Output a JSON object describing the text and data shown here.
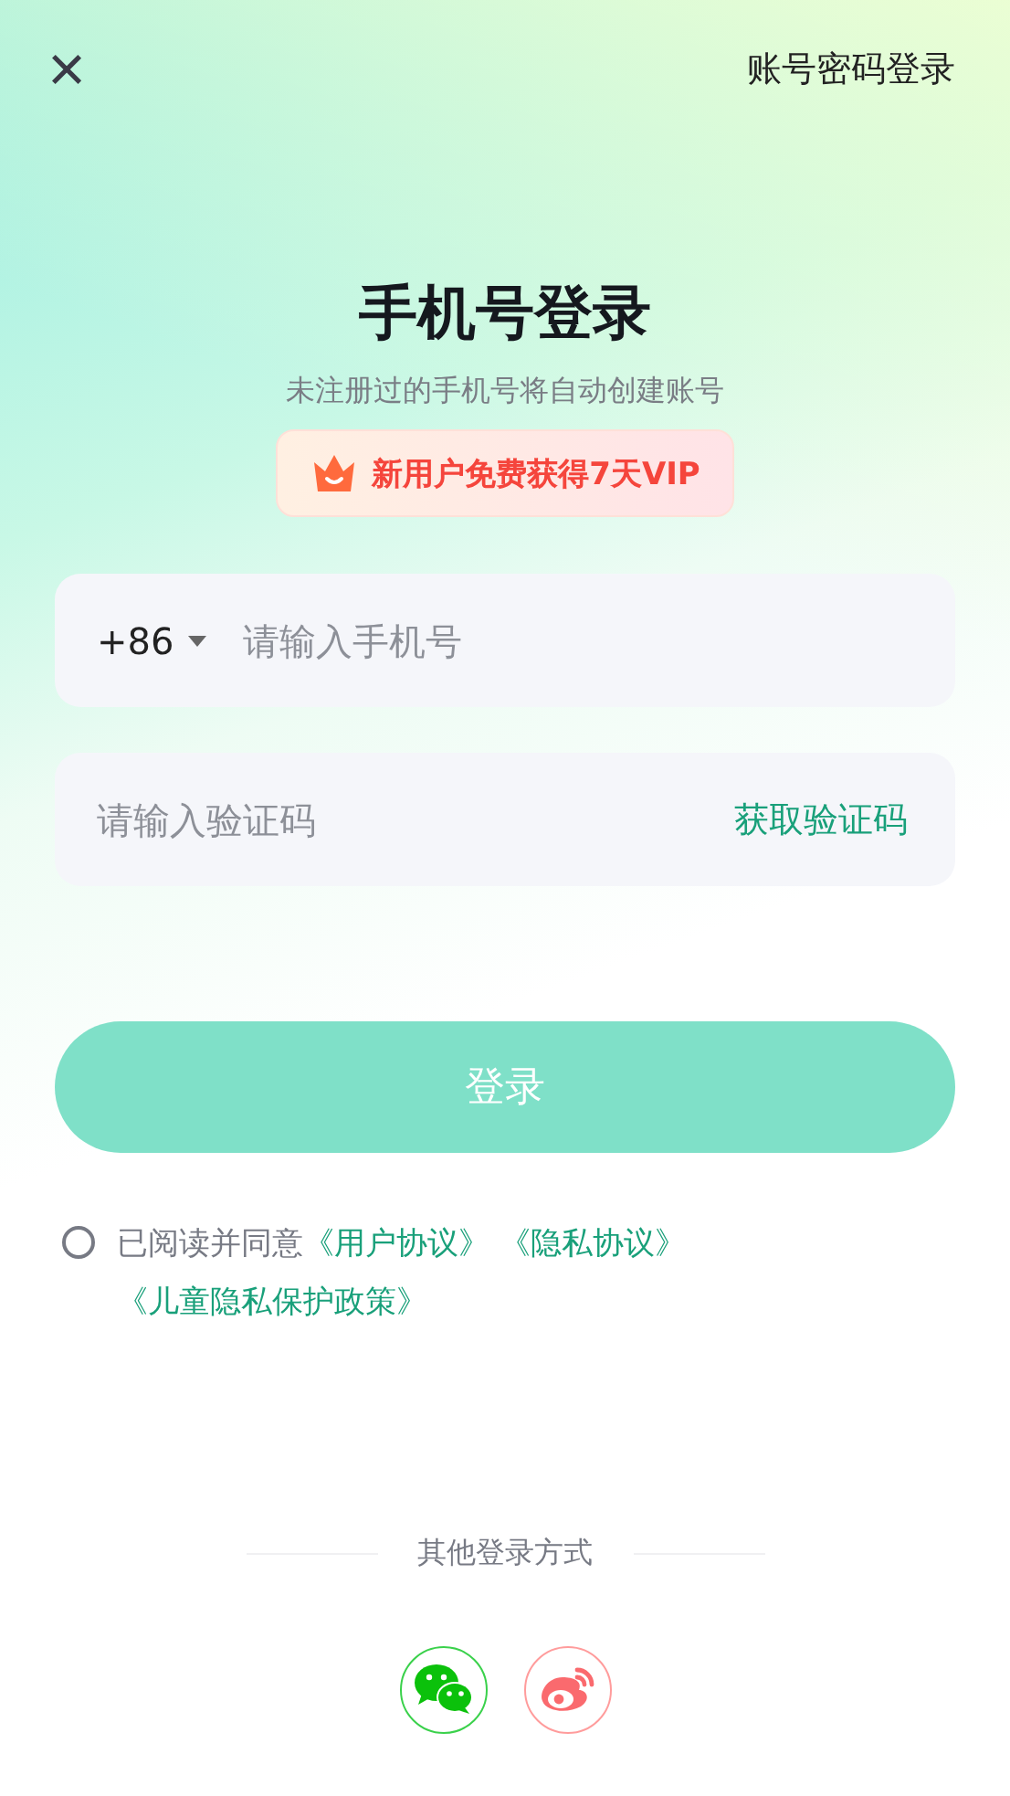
{
  "header": {
    "close": "×",
    "switch_link": "账号密码登录"
  },
  "title": "手机号登录",
  "subtitle": "未注册过的手机号将自动创建账号",
  "promo": {
    "text": "新用户免费获得7天VIP"
  },
  "phone_field": {
    "country_code": "+86",
    "placeholder": "请输入手机号"
  },
  "code_field": {
    "placeholder": "请输入验证码",
    "action": "获取验证码"
  },
  "login_button": {
    "label": "登录",
    "disabled": true
  },
  "agreement": {
    "checked": false,
    "prefix": "已阅读并同意",
    "links": [
      "《用户协议》",
      "《隐私协议》",
      "《儿童隐私保护政策》"
    ]
  },
  "other_login": {
    "label": "其他登录方式",
    "methods": [
      {
        "kind": "wechat"
      },
      {
        "kind": "weibo"
      }
    ]
  }
}
